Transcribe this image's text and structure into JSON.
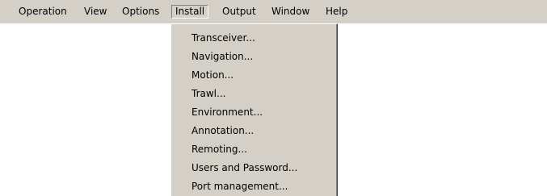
{
  "menubar": {
    "items": [
      {
        "label": "Operation"
      },
      {
        "label": "View"
      },
      {
        "label": "Options"
      },
      {
        "label": "Install"
      },
      {
        "label": "Output"
      },
      {
        "label": "Window"
      },
      {
        "label": "Help"
      }
    ],
    "active_menu": "Install"
  },
  "install_menu": {
    "items": [
      {
        "label": "Transceiver..."
      },
      {
        "label": "Navigation..."
      },
      {
        "label": "Motion..."
      },
      {
        "label": "Trawl..."
      },
      {
        "label": "Environment..."
      },
      {
        "label": "Annotation..."
      },
      {
        "label": "Remoting..."
      },
      {
        "label": "Users and Password..."
      },
      {
        "label": "Port management..."
      }
    ]
  },
  "colors": {
    "menu_background": "#d4d0c8",
    "page_background": "#ffffff",
    "text": "#000000"
  }
}
